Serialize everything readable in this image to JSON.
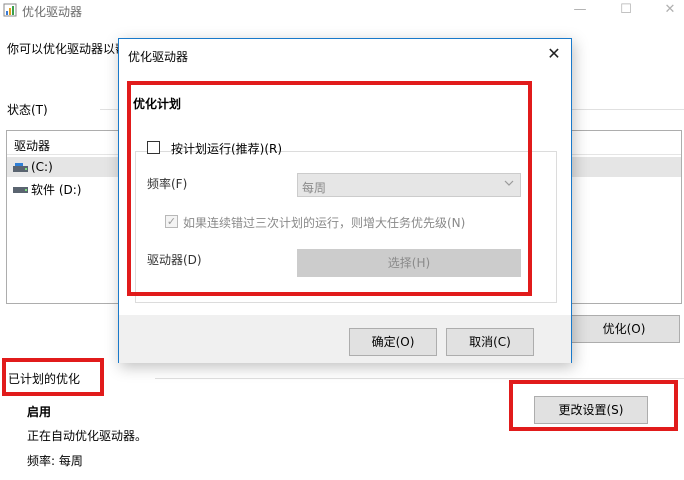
{
  "main_window": {
    "title": "优化驱动器",
    "description": "你可以优化驱动器以帮",
    "status_label": "状态(T)",
    "list_header": "驱动器",
    "drives": [
      {
        "name": "(C:)",
        "selected": true
      },
      {
        "name": "软件 (D:)",
        "selected": false
      }
    ],
    "optimize_button": "优化(O)",
    "scheduled_label": "已计划的优化",
    "enabled_label": "启用",
    "auto_text": "正在自动优化驱动器。",
    "frequency_text": "频率: 每周",
    "change_settings_button": "更改设置(S)",
    "controls": {
      "minimize": "—",
      "maximize": "☐",
      "close": "✕"
    }
  },
  "dialog": {
    "title": "优化驱动器",
    "close_glyph": "✕",
    "heading": "优化计划",
    "schedule_checkbox_label": "按计划运行(推荐)(R)",
    "schedule_checked": false,
    "frequency_label": "频率(F)",
    "frequency_value": "每周",
    "missed_check_glyph": "✓",
    "missed_checkbox_label": "如果连续错过三次计划的运行，则增大任务优先级(N)",
    "missed_checked": true,
    "drives_label": "驱动器(D)",
    "select_button": "选择(H)",
    "ok_button": "确定(O)",
    "cancel_button": "取消(C)"
  },
  "colors": {
    "annotation_red": "#e11b1b",
    "dialog_border": "#1979ca",
    "button_face": "#e1e1e1",
    "disabled_text": "#8a8a8a"
  },
  "icons": [
    "app-icon",
    "drive-icon",
    "close-icon",
    "chevron-down-icon"
  ]
}
